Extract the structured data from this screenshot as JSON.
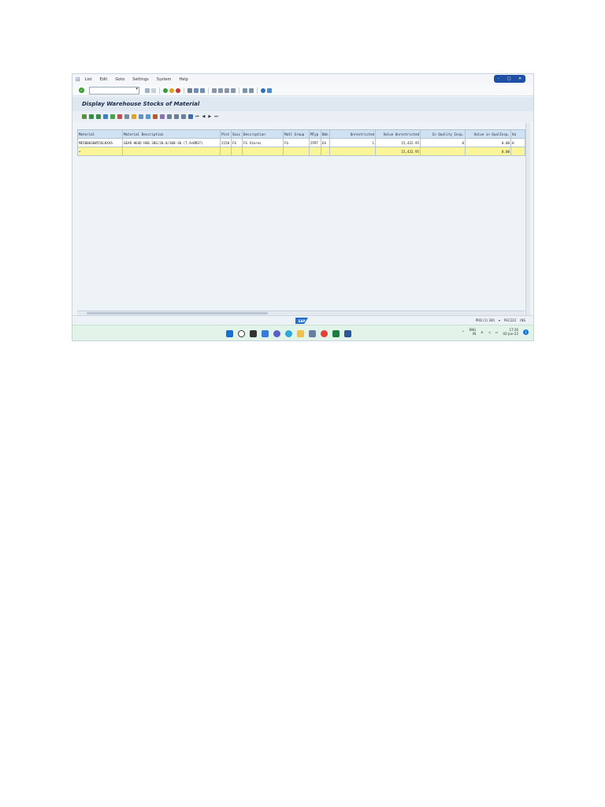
{
  "menu": {
    "items": [
      "List",
      "Edit",
      "Goto",
      "Settings",
      "System",
      "Help"
    ]
  },
  "title": "Display Warehouse Stocks of Material",
  "nav": {
    "first": "⏮",
    "prev": "◀",
    "next": "▶",
    "last": "⏭"
  },
  "grid": {
    "headers": [
      "Material",
      "Material Description",
      "Plnt",
      "SLoc",
      "Description",
      "Matl Group",
      "MTyp",
      "BUn",
      "Unrestricted",
      "Value Unrestricted",
      "In Quality Insp.",
      "Value in QualInsp.",
      "Va"
    ],
    "row": [
      "ME5B0030W55XLKXXA",
      "GEAR HEAD HSB 30G/20.0/300-30 (T.A+BRST)",
      "2150",
      "FG",
      "FG Stores",
      "FG",
      "ZFRT",
      "EA",
      "1",
      "15,432.95",
      "0",
      "0.00",
      "H"
    ],
    "total": {
      "marker": "•",
      "value_unrestricted": "15,432.95",
      "value_in_qualinsp": "0.00"
    }
  },
  "status": {
    "system": "PRD (1) 300",
    "client": "PEC222",
    "mode": "INS"
  },
  "taskbar": {
    "lang": "ENG",
    "region": "IN",
    "time": "17:26",
    "date": "02-Jun-22",
    "notifications": "1"
  },
  "logo": "SAP",
  "colors": {
    "header_cell": "#cfe2f3",
    "total_row": "#fbf59a",
    "taskbar": "#e2f3e9",
    "title_bg": "#dfe8f1"
  }
}
